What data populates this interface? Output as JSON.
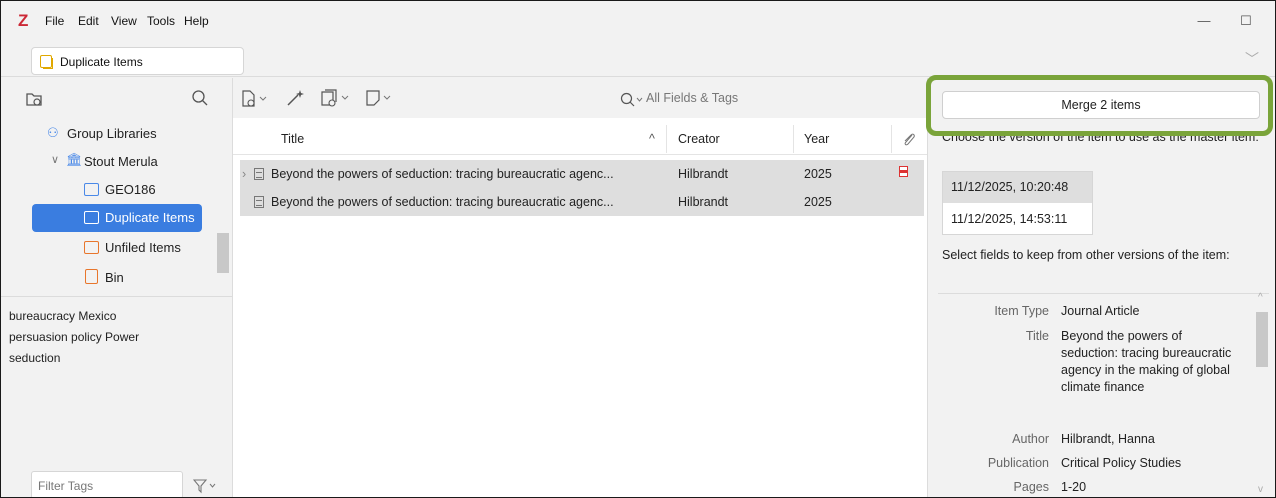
{
  "app": {
    "logo": "Z",
    "menu": [
      "File",
      "Edit",
      "View",
      "Tools",
      "Help"
    ]
  },
  "tab": {
    "label": "Duplicate Items"
  },
  "sidebar": {
    "tree": [
      {
        "label": "Group Libraries",
        "icon": "group-icon"
      },
      {
        "label": "Stout Merula",
        "icon": "library-icon"
      },
      {
        "label": "GEO186",
        "icon": "folder-icon"
      },
      {
        "label": "Duplicate Items",
        "icon": "duplicate-icon",
        "selected": true
      },
      {
        "label": "Unfiled Items",
        "icon": "unfiled-icon"
      },
      {
        "label": "Bin",
        "icon": "bin-icon"
      }
    ],
    "tags": [
      "bureaucracy  Mexico",
      "persuasion  policy  Power",
      "seduction"
    ],
    "filter_placeholder": "Filter Tags"
  },
  "items": {
    "search_placeholder": "All Fields & Tags",
    "columns": {
      "title": "Title",
      "creator": "Creator",
      "year": "Year"
    },
    "rows": [
      {
        "title": "Beyond the powers of seduction: tracing bureaucratic agenc...",
        "creator": "Hilbrandt",
        "year": "2025",
        "has_pdf": true
      },
      {
        "title": "Beyond the powers of seduction: tracing bureaucratic agenc...",
        "creator": "Hilbrandt",
        "year": "2025",
        "has_pdf": false
      }
    ]
  },
  "merge": {
    "button_label": "Merge 2 items",
    "choose_text": "Choose the version of the item to use as the master item:",
    "versions": [
      "11/12/2025, 10:20:48",
      "11/12/2025, 14:53:11"
    ],
    "select_text": "Select fields to keep from other versions of the item:",
    "fields": [
      {
        "key": "Item Type",
        "value": "Journal Article"
      },
      {
        "key": "Title",
        "value": "Beyond the powers of seduction: tracing bureaucratic agency in the making of global climate finance"
      },
      {
        "key": "Author",
        "value": "Hilbrandt, Hanna"
      },
      {
        "key": "Publication",
        "value": "Critical Policy Studies"
      },
      {
        "key": "Pages",
        "value": "1-20"
      }
    ]
  },
  "colors": {
    "accent": "#3a7de0",
    "highlight": "#7aa43a",
    "logo": "#cc2936"
  }
}
